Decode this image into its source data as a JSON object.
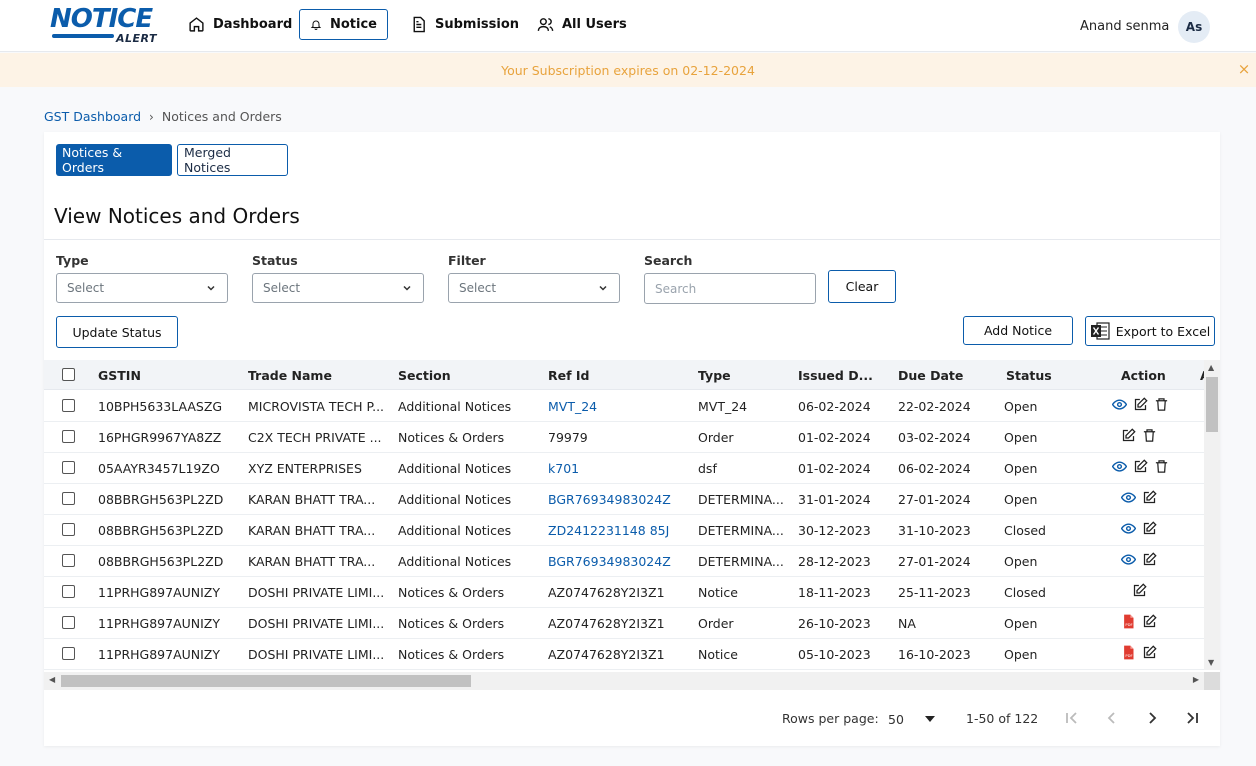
{
  "app": {
    "logo_top": "NOTICE",
    "logo_bottom": "ALERT",
    "nav": [
      {
        "label": "Dashboard",
        "icon": "home-icon"
      },
      {
        "label": "Notice",
        "icon": "bell-icon",
        "active": true
      },
      {
        "label": "Submission",
        "icon": "document-icon"
      },
      {
        "label": "All Users",
        "icon": "users-icon"
      }
    ],
    "user": {
      "name": "Anand senma",
      "initials": "As"
    },
    "accent_color": "#0b5cab"
  },
  "banner": {
    "text": "Your Subscription expires on 02-12-2024",
    "close": "×"
  },
  "breadcrumb": {
    "root": "GST Dashboard",
    "separator": "›",
    "current": "Notices and Orders"
  },
  "tabs": [
    {
      "label": "Notices & Orders",
      "active": true
    },
    {
      "label": "Merged Notices",
      "active": false
    }
  ],
  "page_title": "View Notices and Orders",
  "filters": {
    "type": {
      "label": "Type",
      "value": "Select"
    },
    "status": {
      "label": "Status",
      "value": "Select"
    },
    "filter": {
      "label": "Filter",
      "value": "Select"
    },
    "search": {
      "label": "Search",
      "placeholder": "Search"
    },
    "clear_label": "Clear"
  },
  "toolbar": {
    "update_status": "Update Status",
    "add_notice": "Add Notice",
    "export_excel": "Export to Excel"
  },
  "table": {
    "columns": [
      "GSTIN",
      "Trade Name",
      "Section",
      "Ref Id",
      "Type",
      "Issued D...",
      "Due Date",
      "Status",
      "Action",
      "A"
    ],
    "rows": [
      {
        "gstin": "10BPH5633LAASZG",
        "trade": "MICROVISTA TECH P...",
        "section": "Additional Notices",
        "ref": "MVT_24",
        "ref_link": true,
        "type": "MVT_24",
        "issued": "06-02-2024",
        "due": "22-02-2024",
        "status": "Open",
        "actions": [
          "view",
          "edit",
          "delete"
        ]
      },
      {
        "gstin": "16PHGR9967YA8ZZ",
        "trade": "C2X TECH PRIVATE ...",
        "section": "Notices & Orders",
        "ref": "79979",
        "ref_link": false,
        "type": "Order",
        "issued": "01-02-2024",
        "due": "03-02-2024",
        "status": "Open",
        "actions": [
          "edit",
          "delete"
        ]
      },
      {
        "gstin": "05AAYR3457L19ZO",
        "trade": "XYZ ENTERPRISES",
        "section": "Additional Notices",
        "ref": "k701",
        "ref_link": true,
        "type": "dsf",
        "issued": "01-02-2024",
        "due": "06-02-2024",
        "status": "Open",
        "actions": [
          "view",
          "edit",
          "delete"
        ]
      },
      {
        "gstin": "08BBRGH563PL2ZD",
        "trade": "KARAN BHATT TRA...",
        "section": "Additional Notices",
        "ref": "BGR76934983024Z",
        "ref_link": true,
        "type": "DETERMINA...",
        "issued": "31-01-2024",
        "due": "27-01-2024",
        "status": "Open",
        "actions": [
          "view",
          "edit"
        ]
      },
      {
        "gstin": "08BBRGH563PL2ZD",
        "trade": "KARAN BHATT TRA...",
        "section": "Additional Notices",
        "ref": "ZD2412231148 85J",
        "ref_link": true,
        "type": "DETERMINA...",
        "issued": "30-12-2023",
        "due": "31-10-2023",
        "status": "Closed",
        "actions": [
          "view",
          "edit"
        ]
      },
      {
        "gstin": "08BBRGH563PL2ZD",
        "trade": "KARAN BHATT TRA...",
        "section": "Additional Notices",
        "ref": "BGR76934983024Z",
        "ref_link": true,
        "type": "DETERMINA...",
        "issued": "28-12-2023",
        "due": "27-01-2024",
        "status": "Open",
        "actions": [
          "view",
          "edit"
        ]
      },
      {
        "gstin": "11PRHG897AUNIZY",
        "trade": "DOSHI PRIVATE LIMI...",
        "section": "Notices & Orders",
        "ref": "AZ0747628Y2I3Z1",
        "ref_link": false,
        "type": "Notice",
        "issued": "18-11-2023",
        "due": "25-11-2023",
        "status": "Closed",
        "actions": [
          "edit"
        ]
      },
      {
        "gstin": "11PRHG897AUNIZY",
        "trade": "DOSHI PRIVATE LIMI...",
        "section": "Notices & Orders",
        "ref": "AZ0747628Y2I3Z1",
        "ref_link": false,
        "type": "Order",
        "issued": "26-10-2023",
        "due": "NA",
        "status": "Open",
        "actions": [
          "pdf",
          "edit"
        ]
      },
      {
        "gstin": "11PRHG897AUNIZY",
        "trade": "DOSHI PRIVATE LIMI...",
        "section": "Notices & Orders",
        "ref": "AZ0747628Y2I3Z1",
        "ref_link": false,
        "type": "Notice",
        "issued": "05-10-2023",
        "due": "16-10-2023",
        "status": "Open",
        "actions": [
          "pdf",
          "edit"
        ]
      }
    ]
  },
  "pagination": {
    "rows_per_page_label": "Rows per page:",
    "rows_per_page": "50",
    "range": "1-50 of 122"
  }
}
